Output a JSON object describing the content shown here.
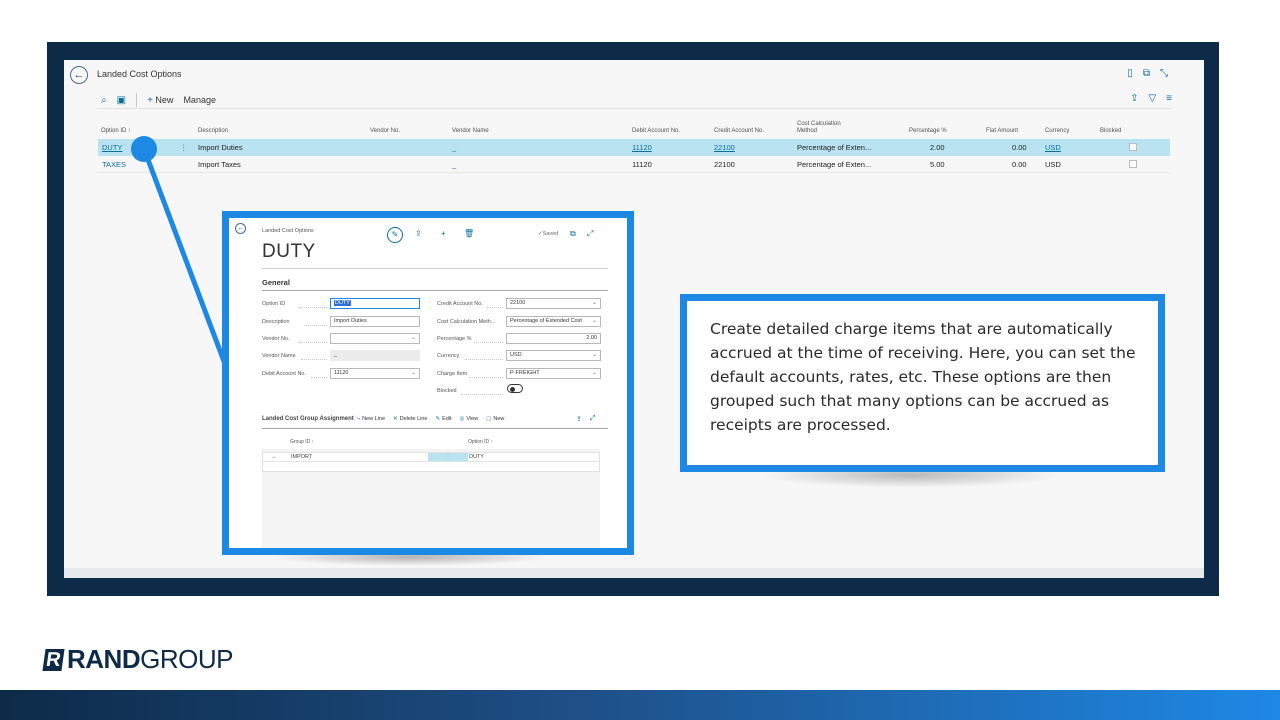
{
  "list_page": {
    "title": "Landed Cost Options",
    "actions": {
      "new": "New",
      "manage": "Manage"
    },
    "columns": {
      "option_id": "Option ID ↑",
      "description": "Description",
      "vendor_no": "Vendor No.",
      "vendor_name": "Vendor Name",
      "debit_account": "Debit Account No.",
      "credit_account": "Credit Account No.",
      "cost_calc_line1": "Cost Calculation",
      "cost_calc_line2": "Method",
      "percentage": "Percentage %",
      "flat_amount": "Flat Amount",
      "currency": "Currency",
      "blocked": "Blocked"
    },
    "rows": [
      {
        "option_id": "DUTY",
        "description": "Import Duties",
        "vendor_name": "_",
        "debit_account": "11120",
        "credit_account": "22100",
        "method": "Percentage of Exten...",
        "percentage": "2.00",
        "flat_amount": "0.00",
        "currency": "USD"
      },
      {
        "option_id": "TAXES",
        "description": "Import Taxes",
        "vendor_name": "_",
        "debit_account": "11120",
        "credit_account": "22100",
        "method": "Percentage of Exten...",
        "percentage": "5.00",
        "flat_amount": "0.00",
        "currency": "USD"
      }
    ]
  },
  "card": {
    "breadcrumb": "Landed Cost Options",
    "title": "DUTY",
    "saved": "✓Saved",
    "section": "General",
    "fields": {
      "option_id_label": "Option ID",
      "option_id_value": "DUTY",
      "description_label": "Description",
      "description_value": "Import Duties",
      "vendor_no_label": "Vendor No.",
      "vendor_no_value": "",
      "vendor_name_label": "Vendor Name",
      "vendor_name_value": "_",
      "debit_label": "Debit Account No.",
      "debit_value": "11120",
      "credit_label": "Credit Account No.",
      "credit_value": "22100",
      "method_label": "Cost Calculation Meth...",
      "method_value": "Percentage of Extended Cost",
      "percentage_label": "Percentage %",
      "percentage_value": "2.00",
      "currency_label": "Currency",
      "currency_value": "USD",
      "charge_item_label": "Charge Item",
      "charge_item_value": "P-FREIGHT",
      "blocked_label": "Blocked"
    },
    "subpage": {
      "title": "Landed Cost Group Assignment",
      "new_line": "New Line",
      "delete_line": "Delete Line",
      "edit": "Edit",
      "view": "View",
      "new": "New",
      "col_group": "Group ID ↑",
      "col_option": "Option ID ↑",
      "row_group": "IMPORT",
      "row_option": "DUTY",
      "row_arrow": "→"
    }
  },
  "callout": {
    "text": "Create detailed charge items that are automatically accrued at the time of receiving. Here, you can set the default accounts, rates, etc. These options are then grouped such that many options can be accrued as receipts are processed."
  },
  "brand": {
    "bold": "RAND",
    "light": "GROUP",
    "mark": "R"
  },
  "colors": {
    "accent": "#1e88e5",
    "navy": "#0d2a48",
    "selected_row": "#b9e3f0",
    "link": "#0a6e9a"
  }
}
